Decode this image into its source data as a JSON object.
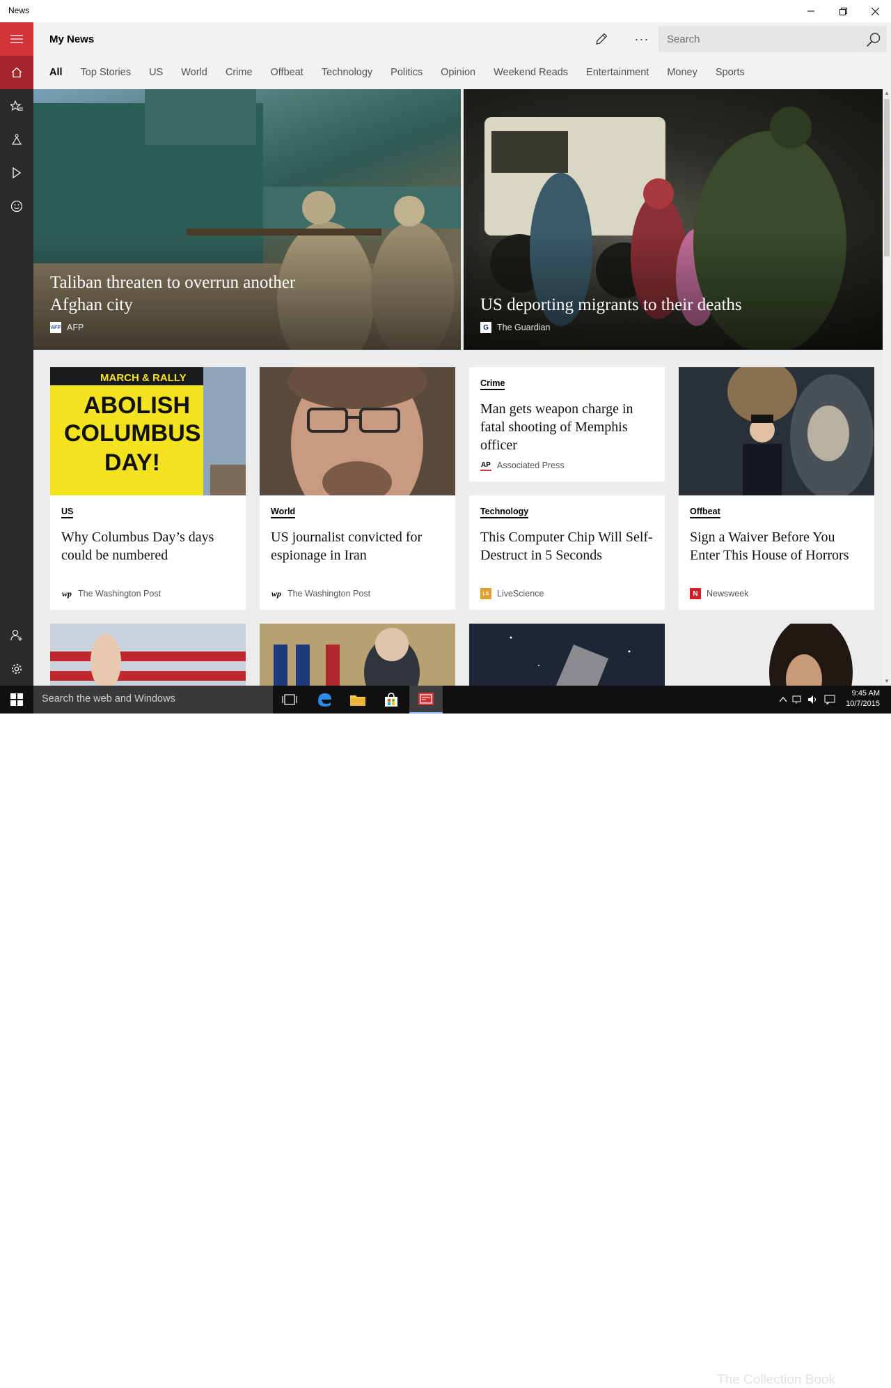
{
  "window": {
    "title": "News"
  },
  "header": {
    "page_title": "My News",
    "search_placeholder": "Search"
  },
  "tabs": [
    {
      "label": "All",
      "active": true
    },
    {
      "label": "Top Stories"
    },
    {
      "label": "US"
    },
    {
      "label": "World"
    },
    {
      "label": "Crime"
    },
    {
      "label": "Offbeat"
    },
    {
      "label": "Technology"
    },
    {
      "label": "Politics"
    },
    {
      "label": "Opinion"
    },
    {
      "label": "Weekend Reads"
    },
    {
      "label": "Entertainment"
    },
    {
      "label": "Money"
    },
    {
      "label": "Sports"
    }
  ],
  "sidebar": {
    "icons": [
      "hamburger-menu-icon",
      "home-icon",
      "favorites-icon",
      "local-icon",
      "video-icon",
      "feedback-icon",
      "sign-in-icon",
      "settings-icon"
    ]
  },
  "hero": [
    {
      "title": "Taliban threaten to overrun another Afghan city",
      "source": "AFP",
      "logo": "AFP"
    },
    {
      "title": "US deporting migrants to their deaths",
      "source": "The Guardian",
      "logo": "G"
    }
  ],
  "cards": [
    {
      "category": "US",
      "headline": "Why Columbus Day’s days could be numbered",
      "source": "The Washington Post",
      "logo": "wp",
      "image_text": "MARCH & RALLY\nABOLISH\nCOLUMBUS\nDAY!"
    },
    {
      "category": "World",
      "headline": "US journalist convicted for espionage in Iran",
      "source": "The Washington Post",
      "logo": "wp"
    },
    {
      "category": "Crime",
      "headline": "Man gets weapon charge in fatal shooting of Memphis officer",
      "source": "Associated Press",
      "logo": "AP"
    },
    {
      "category": "Technology",
      "headline": "This Computer Chip Will Self-Destruct in 5 Seconds",
      "source": "LiveScience",
      "logo": "LS"
    },
    {
      "category": "Offbeat",
      "headline": "Sign a Waiver Before You Enter This House of Horrors",
      "source": "Newsweek",
      "logo": "N"
    }
  ],
  "colors": {
    "accent": "#d13438",
    "accent_dark": "#a4262c",
    "sidebar_bg": "#2b2b2b",
    "taskbar_bg": "#101010"
  },
  "taskbar": {
    "search_text": "Search the web and Windows",
    "time": "9:45 AM",
    "date": "10/7/2015"
  },
  "watermark": "The Collection Book"
}
